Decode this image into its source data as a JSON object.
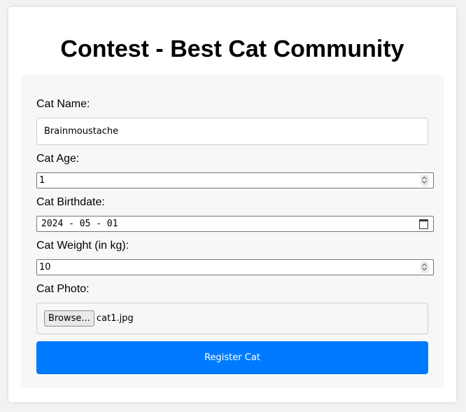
{
  "page": {
    "title": "Contest - Best Cat Community"
  },
  "form": {
    "cat_name": {
      "label": "Cat Name:",
      "value": "Brainmoustache"
    },
    "cat_age": {
      "label": "Cat Age:",
      "value": "1"
    },
    "cat_birthdate": {
      "label": "Cat Birthdate:",
      "value": "2024 - 05 - 01"
    },
    "cat_weight": {
      "label": "Cat Weight (in kg):",
      "value": "10"
    },
    "cat_photo": {
      "label": "Cat Photo:",
      "browse_label": "Browse...",
      "file_name": "cat1.jpg"
    },
    "submit_label": "Register Cat"
  },
  "colors": {
    "accent": "#007bff",
    "background": "#f2f2f2",
    "card": "#ffffff",
    "panel": "#f7f7f7"
  },
  "icons": {
    "spinner": "number-spinner-icon",
    "calendar": "calendar-icon"
  }
}
